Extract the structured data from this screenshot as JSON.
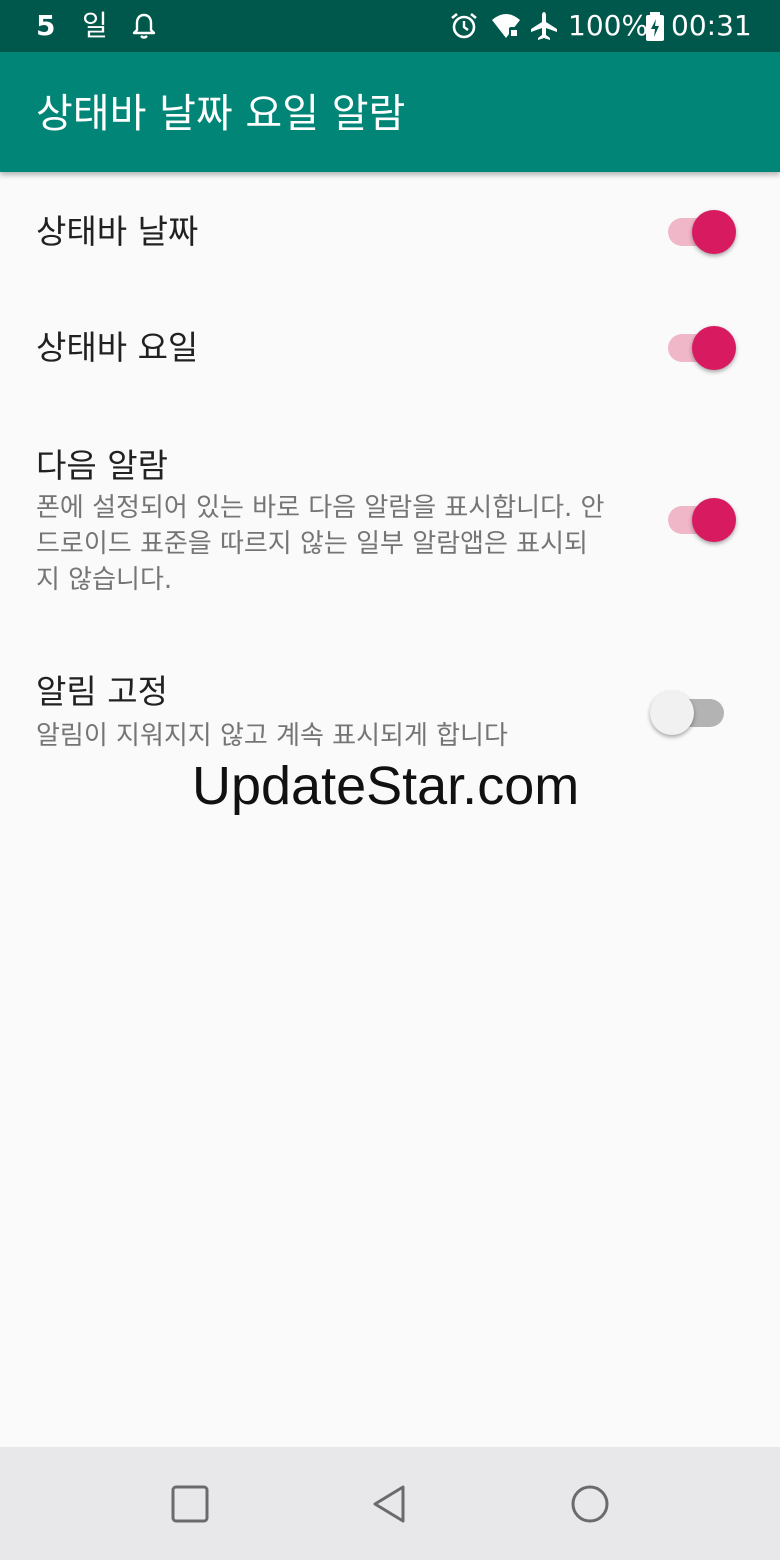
{
  "status_bar": {
    "date_num": "5",
    "day": "일",
    "battery": "100%",
    "time": "00:31",
    "icons": [
      "bell-icon",
      "alarm-clock-icon",
      "wifi-icon",
      "airplane-icon",
      "battery-icon"
    ]
  },
  "app_bar": {
    "title": "상태바 날짜 요일 알람"
  },
  "preferences": [
    {
      "title": "상태바 날짜",
      "checked": true
    },
    {
      "title": "상태바 요일",
      "checked": true
    },
    {
      "title": "다음 알람",
      "summary": "폰에 설정되어 있는 바로 다음 알람을 표시합니다. 안드로이드 표준을 따르지 않는 일부 알람앱은 표시되지 않습니다.",
      "checked": true
    },
    {
      "title": "알림 고정",
      "summary": "알림이 지워지지 않고 계속 표시되게 합니다",
      "checked": false
    }
  ],
  "watermark": "UpdateStar.com",
  "navigation": {
    "buttons": [
      "recent-apps-icon",
      "back-icon",
      "home-icon"
    ]
  },
  "colors": {
    "status_bar": "#00574b",
    "app_bar": "#008577",
    "accent": "#d81b60",
    "track_on": "#f0b7c9",
    "background": "#fafafa",
    "nav_bar": "#e8e8ea"
  }
}
